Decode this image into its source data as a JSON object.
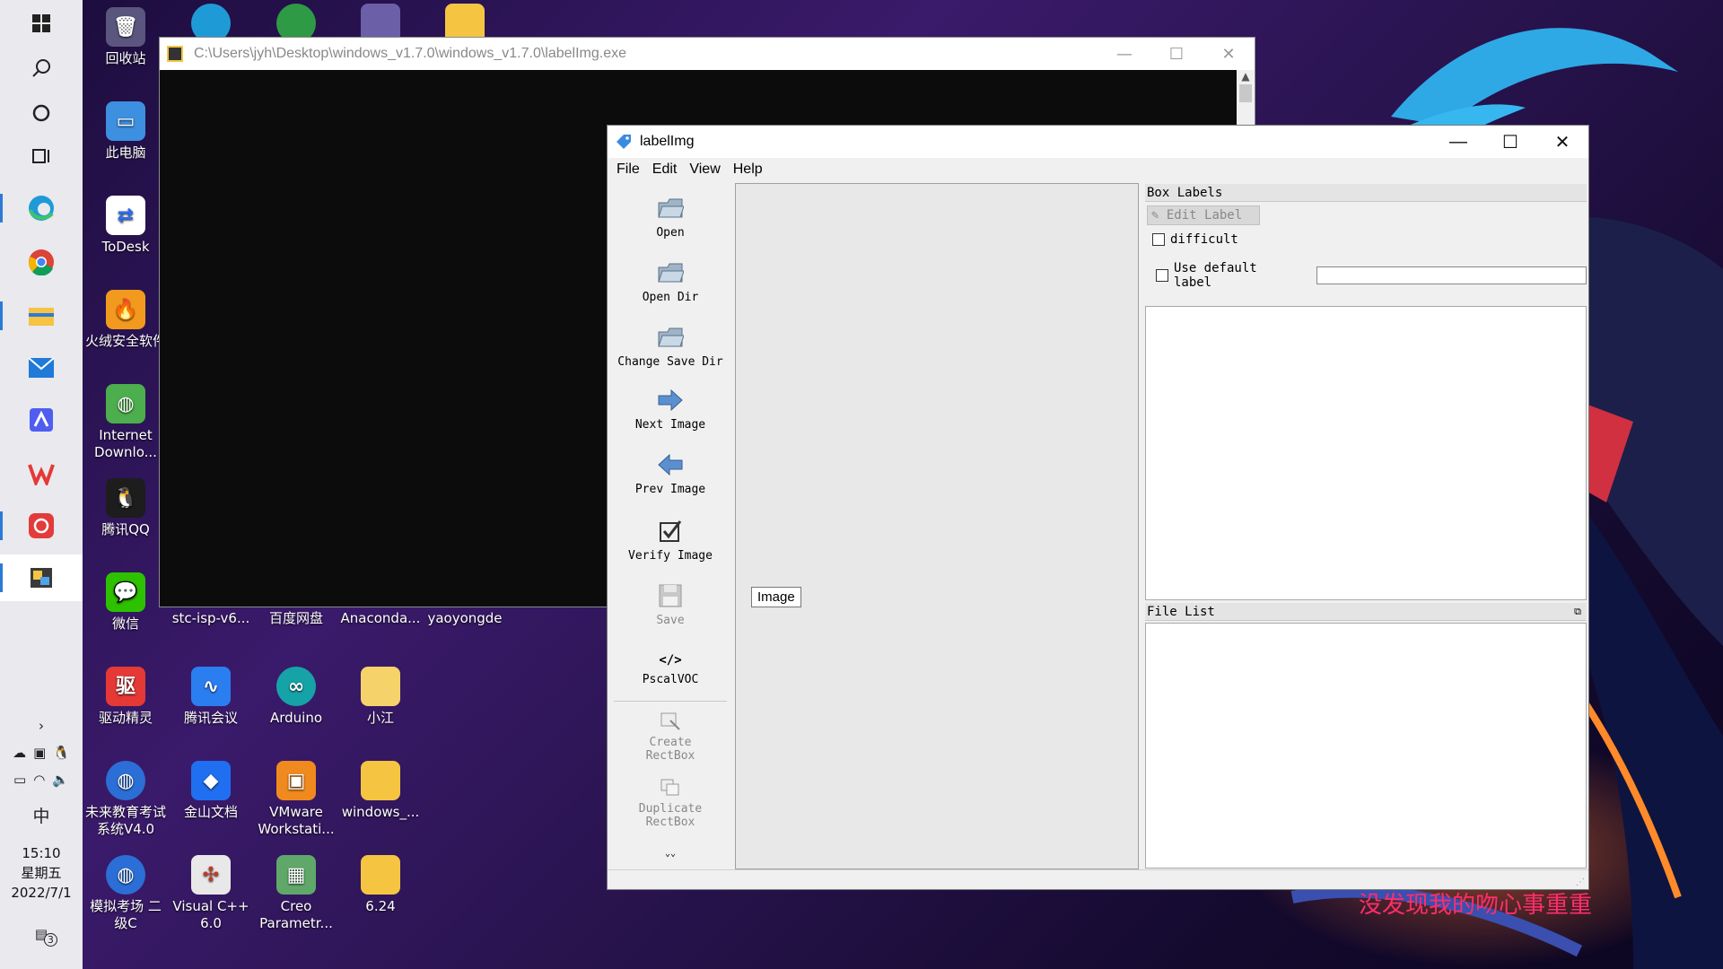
{
  "taskbar": {
    "clock": {
      "time": "15:10",
      "weekday": "星期五",
      "date": "2022/7/1"
    },
    "ime": "中",
    "notification_count": "3"
  },
  "desktop_icons": {
    "recycle_bin": "回收站",
    "this_pc": "此电脑",
    "todesk": "ToDesk",
    "huorong": "火绒安全软件",
    "idm": "Internet Downlo...",
    "qq": "腾讯QQ",
    "wechat": "微信",
    "stc_isp": "stc-isp-v6...",
    "baidu_pan": "百度网盘",
    "anaconda": "Anaconda...",
    "yaoyongde": "yaoyongde",
    "qudong": "驱动精灵",
    "tencent_meeting": "腾讯会议",
    "arduino": "Arduino",
    "xiaojiang": "小江",
    "exam_sys": "未来教育考试系统V4.0",
    "wps_doc": "金山文档",
    "vmware": "VMware Workstati...",
    "windows_folder": "windows_...",
    "sim_exam": "模拟考场 二级C",
    "vcpp": "Visual C++ 6.0",
    "creo": "Creo Parametr...",
    "folder_624": "6.24"
  },
  "console": {
    "title": "C:\\Users\\jyh\\Desktop\\windows_v1.7.0\\windows_v1.7.0\\labelImg.exe"
  },
  "labelimg": {
    "title": "labelImg",
    "menu": [
      "File",
      "Edit",
      "View",
      "Help"
    ],
    "tools": {
      "open": "Open",
      "open_dir": "Open Dir",
      "change_save_dir": "Change Save Dir",
      "next_image": "Next Image",
      "prev_image": "Prev Image",
      "verify_image": "Verify Image",
      "save": "Save",
      "format": "PscalVOC",
      "create_rectbox_1": "Create",
      "create_rectbox_2": "RectBox",
      "duplicate_rectbox_1": "Duplicate",
      "duplicate_rectbox_2": "RectBox"
    },
    "tooltip": "Image",
    "box_labels": {
      "title": "Box Labels",
      "edit_label": "Edit Label",
      "difficult": "difficult",
      "use_default_label": "Use default label",
      "default_label_value": ""
    },
    "file_list": {
      "title": "File List"
    }
  },
  "overlay_text": "没发现我的吻心事重重",
  "colors": {
    "accent": "#2b7bd6",
    "overlay_text": "#ff2d6a"
  }
}
